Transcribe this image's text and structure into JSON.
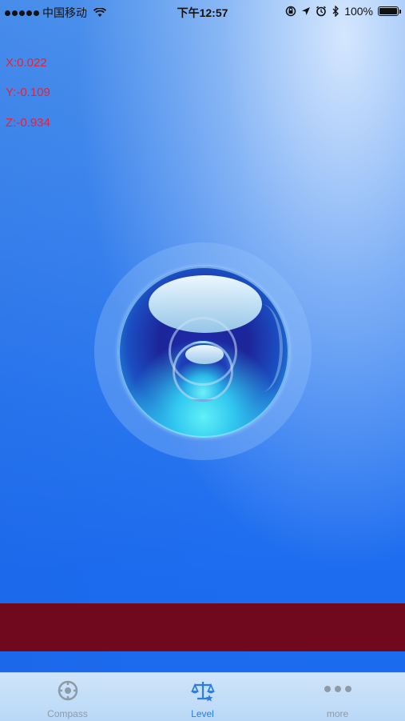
{
  "status_bar": {
    "carrier": "中国移动",
    "time": "下午12:57",
    "battery": "100%"
  },
  "readouts": {
    "x": "X:0.022",
    "y": "Y:-0.109",
    "z": "Z:-0.934"
  },
  "tabs": [
    {
      "label": "Compass",
      "icon": "compass-icon",
      "active": false
    },
    {
      "label": "Level",
      "icon": "level-scale-icon",
      "active": true
    },
    {
      "label": "more",
      "icon": "more-dots-icon",
      "active": false
    }
  ],
  "colors": {
    "readout": "#e6203a",
    "ad_banner": "#70081e",
    "tab_active": "#2a7ee0",
    "tab_inactive": "#8d9aa8"
  }
}
